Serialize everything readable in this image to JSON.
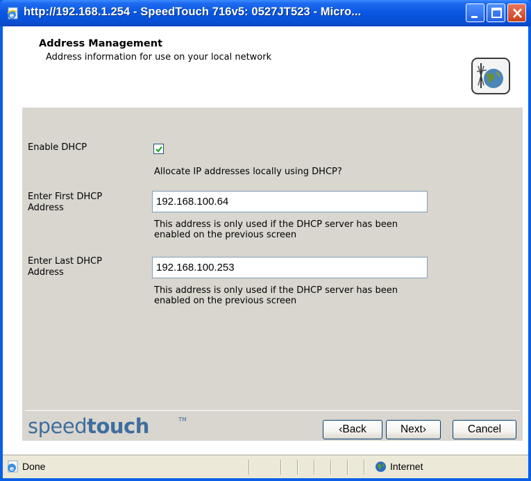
{
  "window": {
    "title": "http://192.168.1.254 - SpeedTouch 716v5: 0527JT523 - Micro...",
    "controls": [
      "minimize",
      "maximize",
      "close"
    ]
  },
  "header": {
    "title": "Address Management",
    "subtitle": "Address information for use on your local network",
    "icon": "network-globe-icon"
  },
  "form": {
    "enable_dhcp": {
      "label": "Enable DHCP",
      "checked": true,
      "help": "Allocate IP addresses locally using DHCP?"
    },
    "first_address": {
      "label_line1": "Enter First DHCP",
      "label_line2": "Address",
      "value": "192.168.100.64",
      "help_line1": "This address is only used if the DHCP server has been",
      "help_line2": "enabled on the previous screen"
    },
    "last_address": {
      "label_line1": "Enter Last DHCP",
      "label_line2": "Address",
      "value": "192.168.100.253",
      "help_line1": "This address is only used if the DHCP server has been",
      "help_line2": "enabled on the previous screen"
    }
  },
  "footer": {
    "logo_light": "speed",
    "logo_bold": "touch",
    "logo_tm": "TM",
    "back_label": "‹Back",
    "next_label": "Next›",
    "cancel_label": "Cancel"
  },
  "statusbar": {
    "status": "Done",
    "zone": "Internet"
  },
  "colors": {
    "titlebar": "#0a58e3",
    "panel": "#d9d6cf",
    "logo": "#3f6e9e"
  }
}
